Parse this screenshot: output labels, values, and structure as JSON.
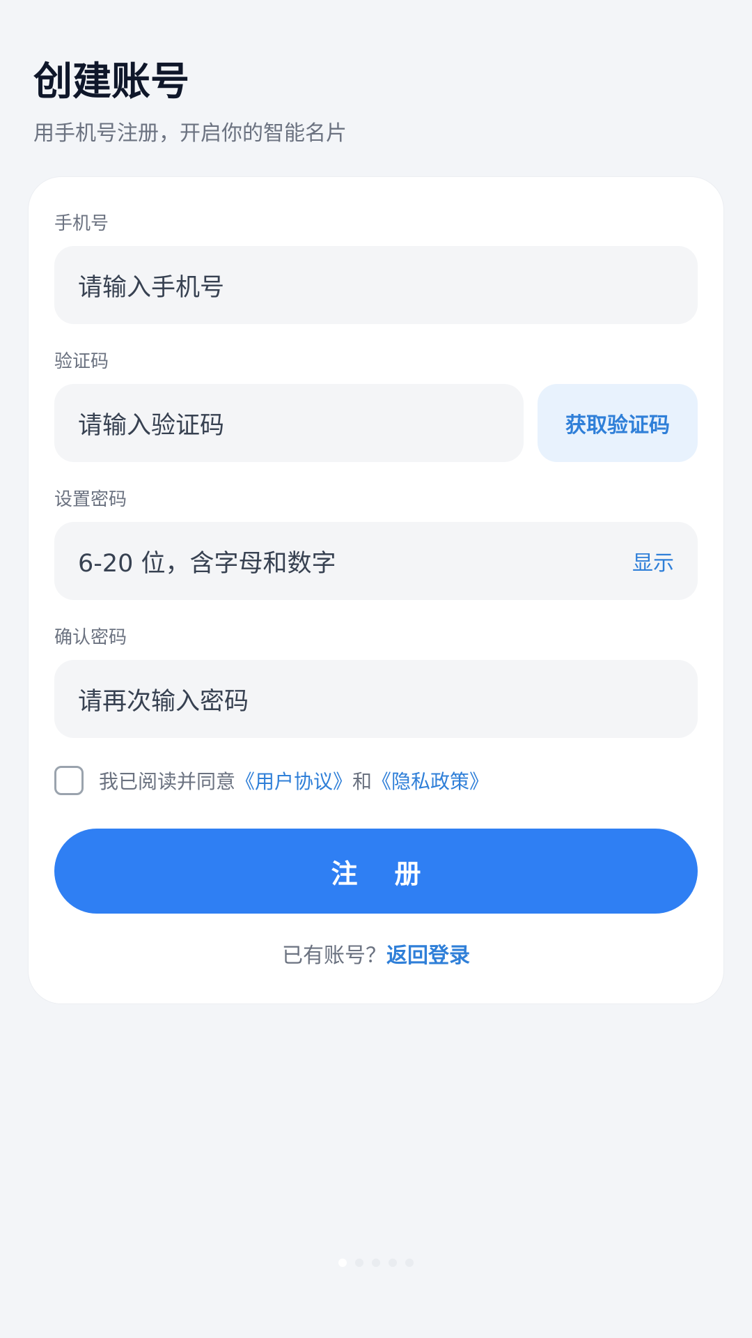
{
  "header": {
    "title": "创建账号",
    "subtitle": "用手机号注册，开启你的智能名片"
  },
  "form": {
    "phone": {
      "label": "手机号",
      "placeholder": "请输入手机号"
    },
    "code": {
      "label": "验证码",
      "placeholder": "请输入验证码",
      "button_label": "获取验证码"
    },
    "password": {
      "label": "设置密码",
      "placeholder": "6-20 位，含字母和数字",
      "toggle_label": "显示"
    },
    "confirm_password": {
      "label": "确认密码",
      "placeholder": "请再次输入密码"
    },
    "agreement": {
      "checked": false,
      "prefix": "我已阅读并同意",
      "user_agreement": "《用户协议》",
      "connector": "和",
      "privacy_policy": "《隐私政策》"
    },
    "submit_label": "注    册"
  },
  "footer": {
    "prompt": "已有账号？",
    "login_link": "返回登录"
  },
  "pager": {
    "total": 5,
    "active_index": 0
  },
  "colors": {
    "accent": "#2f7ff3",
    "link": "#2f7fd8",
    "background": "#f3f5f8"
  }
}
